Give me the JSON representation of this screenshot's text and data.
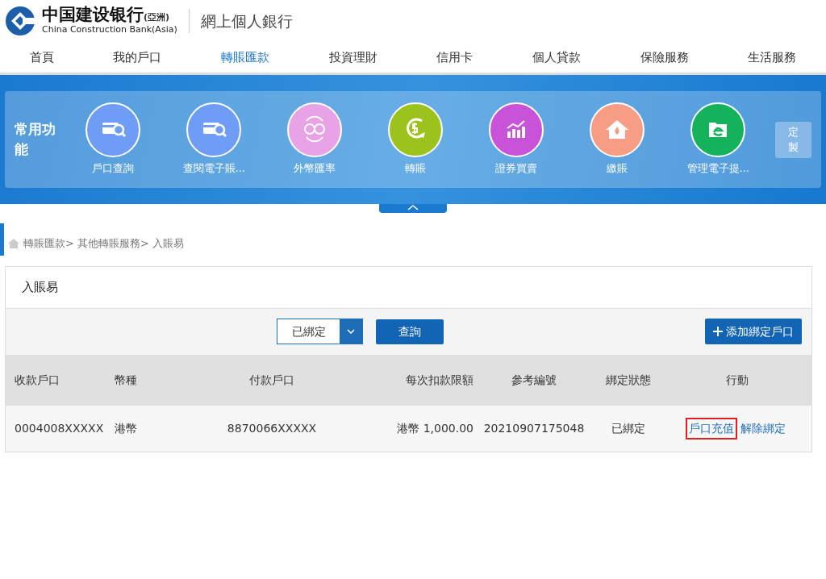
{
  "header": {
    "logo_cn": "中国建设银行",
    "logo_suffix": "(亞洲)",
    "logo_en": "China Construction Bank(Asia)",
    "site_title": "網上個人銀行"
  },
  "nav": [
    {
      "label": "首頁",
      "selected": false
    },
    {
      "label": "我的戶口",
      "selected": false
    },
    {
      "label": "轉賬匯款",
      "selected": true
    },
    {
      "label": "投資理財",
      "selected": false
    },
    {
      "label": "信用卡",
      "selected": false
    },
    {
      "label": "個人貸款",
      "selected": false
    },
    {
      "label": "保險服務",
      "selected": false
    },
    {
      "label": "生活服務",
      "selected": false
    }
  ],
  "quick_functions": {
    "title": "常用功能",
    "customize": "定製",
    "items": [
      {
        "label": "戶口查詢",
        "kind": "card-search",
        "color": "#6f9df5"
      },
      {
        "label": "查閱電子賬...",
        "kind": "card-search",
        "color": "#6f9df5"
      },
      {
        "label": "外幣匯率",
        "kind": "exchange",
        "color": "#e8a3e6"
      },
      {
        "label": "轉賬",
        "kind": "dollar",
        "color": "#9cc31b"
      },
      {
        "label": "證券買賣",
        "kind": "chart",
        "color": "#c853d9"
      },
      {
        "label": "繳賬",
        "kind": "house",
        "color": "#f89d85"
      },
      {
        "label": "管理電子提...",
        "kind": "folder",
        "color": "#14b35b"
      }
    ]
  },
  "breadcrumb": [
    "轉賬匯款>",
    "其他轉賬服務>",
    "入賬易"
  ],
  "panel": {
    "title": "入賬易",
    "status_select": "已綁定",
    "query_button": "查詢",
    "add_button": "添加綁定戶口",
    "table": {
      "columns": [
        "收款戶口",
        "幣種",
        "付款戶口",
        "每次扣款限額",
        "參考編號",
        "綁定狀態",
        "行動"
      ],
      "rows": [
        {
          "cells": [
            "0004008XXXXX",
            "港幣",
            "8870066XXXXX",
            "港幣 1,000.00",
            "20210907175048",
            "已綁定"
          ],
          "actions": [
            {
              "label": "戶口充值",
              "highlighted": true
            },
            {
              "label": "解除綁定",
              "highlighted": false
            }
          ]
        }
      ]
    }
  }
}
